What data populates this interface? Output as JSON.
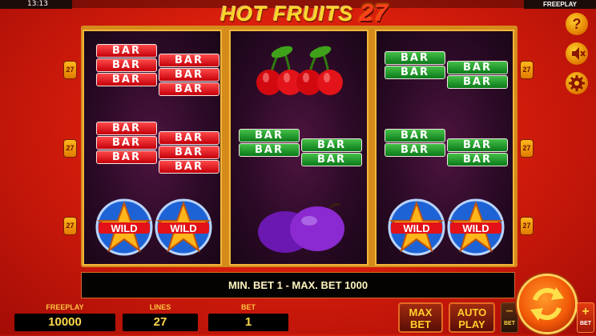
{
  "status": {
    "time": "13:13",
    "mode": "FREEPLAY"
  },
  "logo": {
    "text": "HOT FRUITS",
    "number": "27"
  },
  "reels": {
    "side_marker": "27",
    "bar_label": "BAR",
    "wild_label": "WILD"
  },
  "message": "MIN. BET 1 - MAX. BET 1000",
  "meters": {
    "balance_label": "FREEPLAY",
    "balance_value": "10000",
    "lines_label": "LINES",
    "lines_value": "27",
    "bet_label": "BET",
    "bet_value": "1"
  },
  "buttons": {
    "maxbet_top": "MAX",
    "maxbet_bottom": "BET",
    "autoplay_top": "AUTO",
    "autoplay_bottom": "PLAY",
    "bet_minus_label": "BET",
    "bet_plus_label": "BET",
    "help_glyph": "?"
  },
  "colors": {
    "bar_red": "#e0101a",
    "bar_green": "#1aa02a",
    "reel_bg": "#2a0a25",
    "gold": "#ffc640"
  },
  "icons": [
    "help-icon",
    "sound-off-icon",
    "settings-gear-icon",
    "spin-arrows-icon"
  ]
}
